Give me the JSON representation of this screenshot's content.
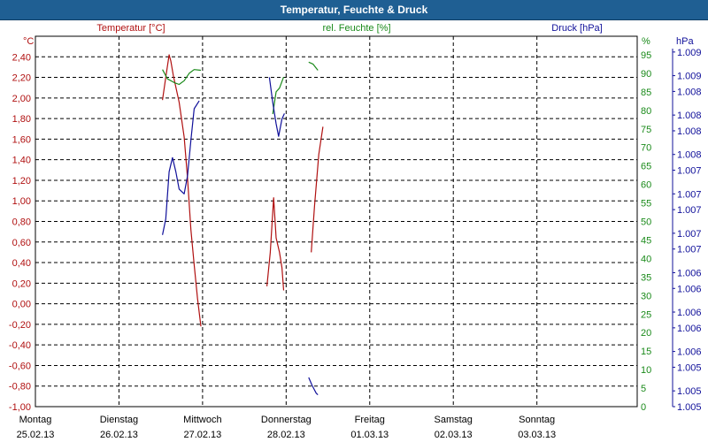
{
  "window": {
    "title": "Temperatur, Feuchte & Druck"
  },
  "colors": {
    "temperature": "#b01010",
    "humidity": "#1a8a1a",
    "pressure": "#10109a",
    "grid": "#000000",
    "titlebar": "#1f5f93"
  },
  "chart_data": {
    "type": "line",
    "title": "Temperatur, Feuchte & Druck",
    "grid": true,
    "x_ticks": [
      {
        "day": "Montag",
        "date": "25.02.13"
      },
      {
        "day": "Dienstag",
        "date": "26.02.13"
      },
      {
        "day": "Mittwoch",
        "date": "27.02.13"
      },
      {
        "day": "Donnerstag",
        "date": "28.02.13"
      },
      {
        "day": "Freitag",
        "date": "01.03.13"
      },
      {
        "day": "Samstag",
        "date": "02.03.13"
      },
      {
        "day": "Sonntag",
        "date": "03.03.13"
      }
    ],
    "xlim": [
      0,
      7.2
    ],
    "axes": {
      "temperature": {
        "unit": "°C",
        "label": "Temperatur [°C]",
        "ylim": [
          -1.0,
          2.6
        ],
        "ticks": [
          "2,40",
          "2,20",
          "2,00",
          "1,80",
          "1,60",
          "1,40",
          "1,20",
          "1,00",
          "0,80",
          "0,60",
          "0,40",
          "0,20",
          "0,00",
          "-0,20",
          "-0,40",
          "-0,60",
          "-0,80",
          "-1,00"
        ],
        "tick_values": [
          2.4,
          2.2,
          2.0,
          1.8,
          1.6,
          1.4,
          1.2,
          1.0,
          0.8,
          0.6,
          0.4,
          0.2,
          0.0,
          -0.2,
          -0.4,
          -0.6,
          -0.8,
          -1.0
        ]
      },
      "humidity": {
        "unit": "%",
        "label": "rel. Feuchte [%]",
        "ylim": [
          0,
          100
        ],
        "ticks": [
          "95",
          "90",
          "85",
          "80",
          "75",
          "70",
          "65",
          "60",
          "55",
          "50",
          "45",
          "40",
          "35",
          "30",
          "25",
          "20",
          "15",
          "10",
          "5",
          "0"
        ],
        "tick_values": [
          95,
          90,
          85,
          80,
          75,
          70,
          65,
          60,
          55,
          50,
          45,
          40,
          35,
          30,
          25,
          20,
          15,
          10,
          5,
          0
        ]
      },
      "pressure": {
        "unit": "hPa",
        "label": "Druck [hPa]",
        "ylim": [
          1.0048,
          1.0095
        ],
        "ticks": [
          "1.009",
          "1.009",
          "1.008",
          "1.008",
          "1.008",
          "1.008",
          "1.007",
          "1.007",
          "1.007",
          "1.007",
          "1.007",
          "1.006",
          "1.006",
          "1.006",
          "1.006",
          "1.006",
          "1.005",
          "1.005",
          "1.005"
        ],
        "tick_values": [
          1.0093,
          1.009,
          1.0088,
          1.0085,
          1.0083,
          1.008,
          1.0078,
          1.0075,
          1.0073,
          1.007,
          1.0068,
          1.0065,
          1.0063,
          1.006,
          1.0058,
          1.0055,
          1.0053,
          1.005,
          1.0048
        ]
      }
    },
    "series": [
      {
        "name": "Temperatur [°C]",
        "axis": "temperature",
        "segments": [
          [
            [
              1.52,
              1.98
            ],
            [
              1.56,
              2.2
            ],
            [
              1.6,
              2.42
            ],
            [
              1.62,
              2.36
            ],
            [
              1.65,
              2.22
            ],
            [
              1.72,
              1.96
            ],
            [
              1.78,
              1.62
            ],
            [
              1.82,
              1.22
            ],
            [
              1.86,
              0.72
            ],
            [
              1.9,
              0.38
            ],
            [
              1.94,
              0.05
            ],
            [
              1.98,
              -0.22
            ]
          ],
          [
            [
              2.77,
              0.17
            ],
            [
              2.81,
              0.5
            ],
            [
              2.85,
              1.03
            ],
            [
              2.88,
              0.64
            ],
            [
              2.92,
              0.5
            ],
            [
              2.95,
              0.35
            ],
            [
              2.97,
              0.13
            ]
          ],
          [
            [
              3.3,
              0.5
            ],
            [
              3.34,
              0.95
            ],
            [
              3.39,
              1.45
            ],
            [
              3.44,
              1.72
            ]
          ]
        ]
      },
      {
        "name": "rel. Feuchte [%]",
        "axis": "humidity",
        "segments": [
          [
            [
              1.52,
              91
            ],
            [
              1.58,
              88.5
            ],
            [
              1.66,
              87.5
            ],
            [
              1.72,
              87
            ],
            [
              1.78,
              88
            ],
            [
              1.84,
              90
            ],
            [
              1.9,
              91
            ],
            [
              1.98,
              90.8
            ]
          ],
          [
            [
              2.84,
              79
            ],
            [
              2.88,
              85
            ],
            [
              2.92,
              86
            ],
            [
              2.97,
              89
            ]
          ],
          [
            [
              3.27,
              93
            ],
            [
              3.32,
              92.5
            ],
            [
              3.38,
              90.8
            ]
          ]
        ]
      },
      {
        "name": "Druck [hPa]",
        "axis": "pressure",
        "segments": [
          [
            [
              1.52,
              1.00698
            ],
            [
              1.56,
              1.00718
            ],
            [
              1.6,
              1.00778
            ],
            [
              1.64,
              1.00796
            ],
            [
              1.68,
              1.00778
            ],
            [
              1.72,
              1.00756
            ],
            [
              1.78,
              1.0075
            ],
            [
              1.82,
              1.00773
            ],
            [
              1.86,
              1.00818
            ],
            [
              1.9,
              1.00858
            ],
            [
              1.96,
              1.00868
            ]
          ],
          [
            [
              2.8,
              1.00898
            ],
            [
              2.84,
              1.00866
            ],
            [
              2.88,
              1.00839
            ],
            [
              2.91,
              1.00823
            ],
            [
              2.95,
              1.00845
            ],
            [
              2.98,
              1.00852
            ]
          ],
          [
            [
              3.27,
              1.00517
            ],
            [
              3.31,
              1.00507
            ],
            [
              3.36,
              1.00497
            ],
            [
              3.38,
              1.00495
            ]
          ]
        ]
      }
    ]
  }
}
